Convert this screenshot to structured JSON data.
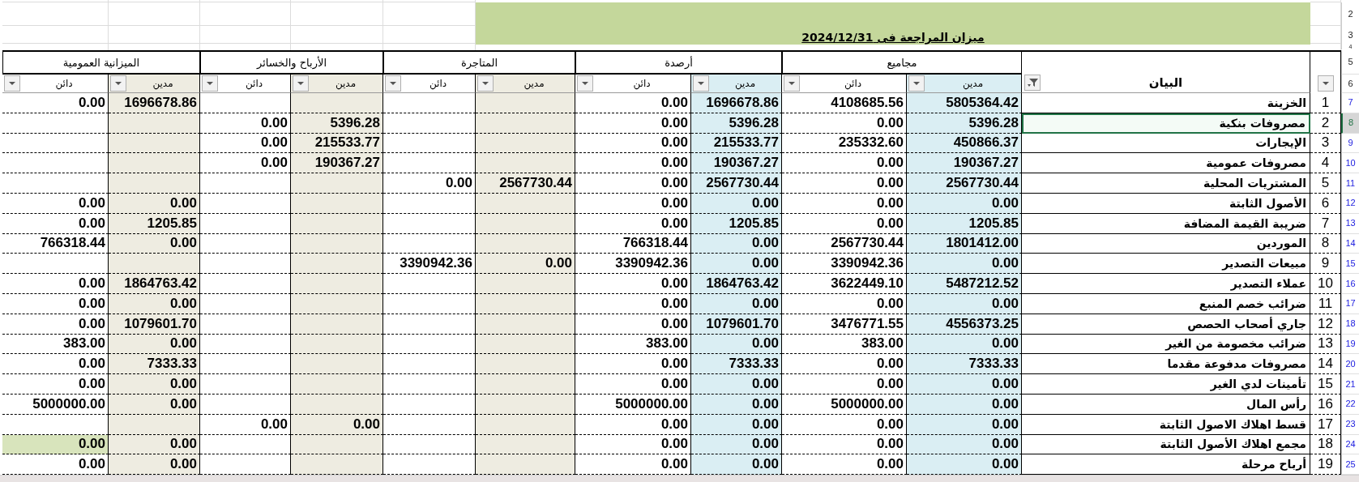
{
  "title": "ميزان المراجعة فى 2024/12/31",
  "top_row_numbers": [
    "2",
    "3",
    "4"
  ],
  "groups": [
    {
      "title": "مجاميع",
      "color": "#daeef3",
      "columns": [
        {
          "label": "مدين",
          "filtered": false
        },
        {
          "label": "دائن",
          "filtered": false
        }
      ]
    },
    {
      "title": "أرصدة",
      "color": "#daeef3",
      "columns": [
        {
          "label": "مدين",
          "filtered": false
        },
        {
          "label": "دائن",
          "filtered": false
        }
      ]
    },
    {
      "title": "المتاجرة",
      "color": "#eeece1",
      "columns": [
        {
          "label": "مدين",
          "filtered": false
        },
        {
          "label": "دائن",
          "filtered": false
        }
      ]
    },
    {
      "title": "الأرباح والخسائر",
      "color": "#eeece1",
      "columns": [
        {
          "label": "مدين",
          "filtered": false
        },
        {
          "label": "دائن",
          "filtered": false
        }
      ]
    },
    {
      "title": "الميزانية العمومية",
      "color": "#eeece1",
      "columns": [
        {
          "label": "مدين",
          "filtered": false
        },
        {
          "label": "دائن",
          "filtered": false
        }
      ]
    }
  ],
  "label_header": {
    "filtered": true,
    "text": "البيان"
  },
  "number_header": {
    "filtered": false
  },
  "header_row_numbers": [
    "5",
    "6"
  ],
  "rows": [
    {
      "balance_credit_highlighted": false,
      "cells": [
        "0.00",
        "1696678.86",
        null,
        null,
        null,
        null,
        "0.00",
        "1696678.86",
        "4108685.56",
        "5805364.42"
      ],
      "label": "الخزينة",
      "selected": false,
      "no": "1",
      "row_number": "7"
    },
    {
      "balance_credit_highlighted": false,
      "cells": [
        null,
        null,
        "0.00",
        "5396.28",
        null,
        null,
        "0.00",
        "5396.28",
        "0.00",
        "5396.28"
      ],
      "label": "مصروفات بنكية",
      "selected": true,
      "no": "2",
      "row_number": "8"
    },
    {
      "balance_credit_highlighted": false,
      "cells": [
        null,
        null,
        "0.00",
        "215533.77",
        null,
        null,
        "0.00",
        "215533.77",
        "235332.60",
        "450866.37"
      ],
      "label": "الإيجارات",
      "selected": false,
      "no": "3",
      "row_number": "9"
    },
    {
      "balance_credit_highlighted": false,
      "cells": [
        null,
        null,
        "0.00",
        "190367.27",
        null,
        null,
        "0.00",
        "190367.27",
        "0.00",
        "190367.27"
      ],
      "label": "مصروفات عمومية",
      "selected": false,
      "no": "4",
      "row_number": "10"
    },
    {
      "balance_credit_highlighted": false,
      "cells": [
        null,
        null,
        null,
        null,
        "0.00",
        "2567730.44",
        "0.00",
        "2567730.44",
        "0.00",
        "2567730.44"
      ],
      "label": "المشتريات المحلية",
      "selected": false,
      "no": "5",
      "row_number": "11"
    },
    {
      "balance_credit_highlighted": false,
      "cells": [
        "0.00",
        "0.00",
        null,
        null,
        null,
        null,
        "0.00",
        "0.00",
        "0.00",
        "0.00"
      ],
      "label": "الأصول الثابتة",
      "selected": false,
      "no": "6",
      "row_number": "12"
    },
    {
      "balance_credit_highlighted": false,
      "cells": [
        "0.00",
        "1205.85",
        null,
        null,
        null,
        null,
        "0.00",
        "1205.85",
        "0.00",
        "1205.85"
      ],
      "label": "ضريبة القيمة المضافة",
      "selected": false,
      "no": "7",
      "row_number": "13"
    },
    {
      "balance_credit_highlighted": false,
      "cells": [
        "766318.44",
        "0.00",
        null,
        null,
        null,
        null,
        "766318.44",
        "0.00",
        "2567730.44",
        "1801412.00"
      ],
      "label": "الموردين",
      "selected": false,
      "no": "8",
      "row_number": "14"
    },
    {
      "balance_credit_highlighted": false,
      "cells": [
        null,
        null,
        null,
        null,
        "3390942.36",
        "0.00",
        "3390942.36",
        "0.00",
        "3390942.36",
        "0.00"
      ],
      "label": "مبيعات التصدير",
      "selected": false,
      "no": "9",
      "row_number": "15"
    },
    {
      "balance_credit_highlighted": false,
      "cells": [
        "0.00",
        "1864763.42",
        null,
        null,
        null,
        null,
        "0.00",
        "1864763.42",
        "3622449.10",
        "5487212.52"
      ],
      "label": "عملاء التصدير",
      "selected": false,
      "no": "10",
      "row_number": "16"
    },
    {
      "balance_credit_highlighted": false,
      "cells": [
        "0.00",
        "0.00",
        null,
        null,
        null,
        null,
        "0.00",
        "0.00",
        "0.00",
        "0.00"
      ],
      "label": "ضرائب خصم المنبع",
      "selected": false,
      "no": "11",
      "row_number": "17"
    },
    {
      "balance_credit_highlighted": false,
      "cells": [
        "0.00",
        "1079601.70",
        null,
        null,
        null,
        null,
        "0.00",
        "1079601.70",
        "3476771.55",
        "4556373.25"
      ],
      "label": "جاري أصحاب الحصص",
      "selected": false,
      "no": "12",
      "row_number": "18"
    },
    {
      "balance_credit_highlighted": false,
      "cells": [
        "383.00",
        "0.00",
        null,
        null,
        null,
        null,
        "383.00",
        "0.00",
        "383.00",
        "0.00"
      ],
      "label": "ضرائب مخصومة من الغير",
      "selected": false,
      "no": "13",
      "row_number": "19"
    },
    {
      "balance_credit_highlighted": false,
      "cells": [
        "0.00",
        "7333.33",
        null,
        null,
        null,
        null,
        "0.00",
        "7333.33",
        "0.00",
        "7333.33"
      ],
      "label": "مصروفات مدفوعة مقدما",
      "selected": false,
      "no": "14",
      "row_number": "20"
    },
    {
      "balance_credit_highlighted": false,
      "cells": [
        "0.00",
        "0.00",
        null,
        null,
        null,
        null,
        "0.00",
        "0.00",
        "0.00",
        "0.00"
      ],
      "label": "تأمينات لدي الغير",
      "selected": false,
      "no": "15",
      "row_number": "21"
    },
    {
      "balance_credit_highlighted": false,
      "cells": [
        "5000000.00",
        "0.00",
        null,
        null,
        null,
        null,
        "5000000.00",
        "0.00",
        "5000000.00",
        "0.00"
      ],
      "label": "رأس المال",
      "selected": false,
      "no": "16",
      "row_number": "22"
    },
    {
      "balance_credit_highlighted": false,
      "cells": [
        null,
        null,
        "0.00",
        "0.00",
        null,
        null,
        "0.00",
        "0.00",
        "0.00",
        "0.00"
      ],
      "label": "قسط اهلاك الاصول الثابتة",
      "selected": false,
      "no": "17",
      "row_number": "23"
    },
    {
      "balance_credit_highlighted": true,
      "cells": [
        "0.00",
        "0.00",
        null,
        null,
        null,
        null,
        "0.00",
        "0.00",
        "0.00",
        "0.00"
      ],
      "label": "مجمع اهلاك الأصول الثابتة",
      "selected": false,
      "no": "18",
      "row_number": "24"
    },
    {
      "balance_credit_highlighted": false,
      "cells": [
        "0.00",
        "0.00",
        null,
        null,
        null,
        null,
        "0.00",
        "0.00",
        "0.00",
        "0.00"
      ],
      "label": "أرباح مرحلة",
      "selected": false,
      "no": "19",
      "row_number": "25"
    }
  ]
}
